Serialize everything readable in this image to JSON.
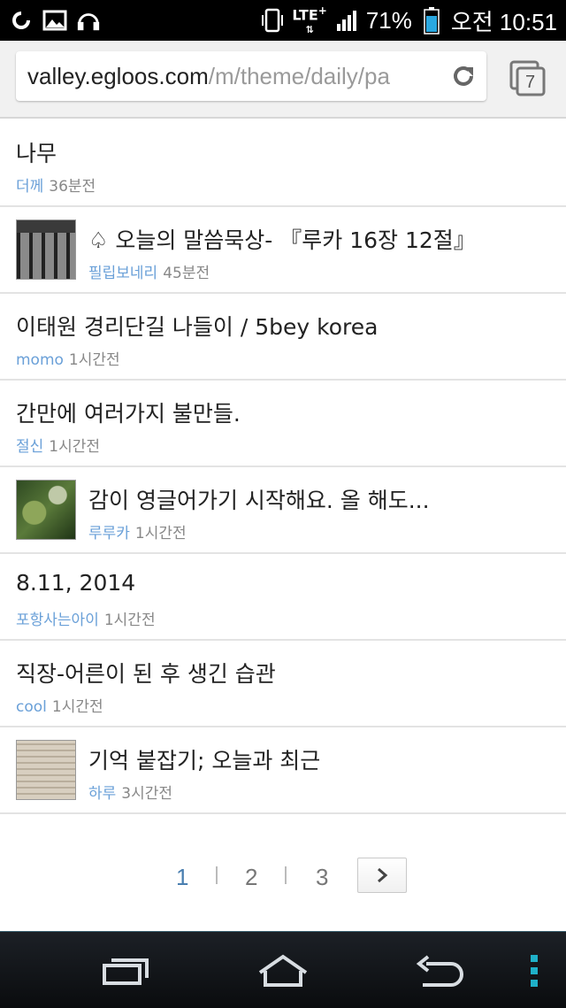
{
  "status_bar": {
    "network": "LTE",
    "battery": "71%",
    "time": "오전 10:51",
    "icons": [
      "swirl-app-icon",
      "gallery-icon",
      "headphones-icon",
      "phone-vibrate-icon",
      "signal-icon",
      "battery-icon"
    ]
  },
  "browser": {
    "url_domain": "valley.egloos.com",
    "url_path": "/m/theme/daily/pa",
    "tab_count": "7"
  },
  "posts": [
    {
      "title": "나무",
      "author": "더께",
      "time": "36분전",
      "thumbnail": false
    },
    {
      "title": "♤ 오늘의 말씀묵상- 『루카 16장 12절』",
      "author": "필립보네리",
      "time": "45분전",
      "thumbnail": true
    },
    {
      "title": "이태원 경리단길 나들이 / 5bey korea",
      "author": "momo",
      "time": "1시간전",
      "thumbnail": false
    },
    {
      "title": "간만에 여러가지 불만들.",
      "author": "절신",
      "time": "1시간전",
      "thumbnail": false
    },
    {
      "title": "감이 영글어가기 시작해요. 올 해도...",
      "author": "루루카",
      "time": "1시간전",
      "thumbnail": true
    },
    {
      "title": "8.11, 2014",
      "author": "포항사는아이",
      "time": "1시간전",
      "thumbnail": false
    },
    {
      "title": "직장-어른이 된 후 생긴 습관",
      "author": "cool",
      "time": "1시간전",
      "thumbnail": false
    },
    {
      "title": "기억 붙잡기; 오늘과 최근",
      "author": "하루",
      "time": "3시간전",
      "thumbnail": true
    }
  ],
  "pagination": {
    "pages": [
      "1",
      "2",
      "3"
    ],
    "current": "1"
  },
  "colors": {
    "author": "#6aa0d8",
    "active_page": "#4a7fb0",
    "divider": "#e3e3e3"
  }
}
